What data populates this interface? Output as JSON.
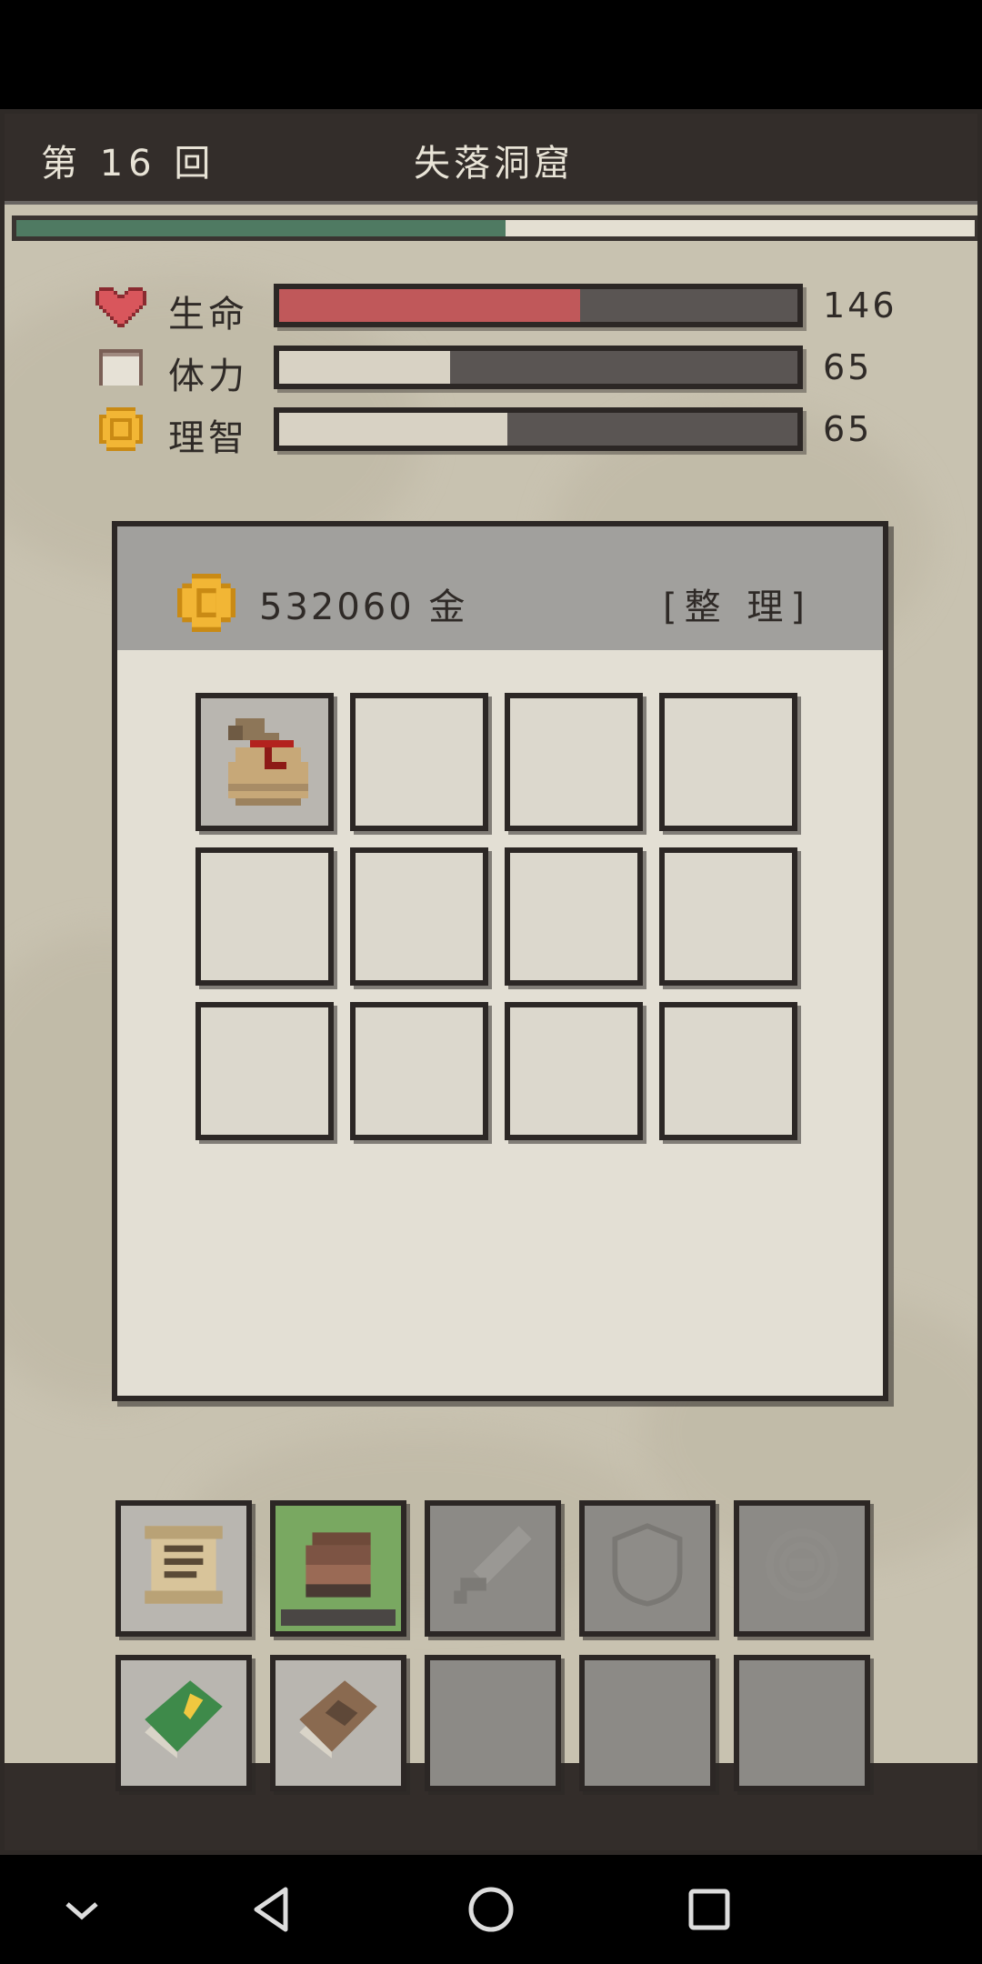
{
  "header": {
    "round": "第 16 回",
    "location": "失落洞窟"
  },
  "progress": {
    "fraction": 0.51,
    "fill_color": "#4f7a62"
  },
  "stats": [
    {
      "name": "生命",
      "icon": "heart-icon",
      "value": "146",
      "fraction": 0.58,
      "color": "#c0585a"
    },
    {
      "name": "体力",
      "icon": "stamina-icon",
      "value": "65",
      "fraction": 0.33,
      "color": "#d8d2c4"
    },
    {
      "name": "理智",
      "icon": "sanity-coin-icon",
      "value": "65",
      "fraction": 0.44,
      "color": "#d8d2c4"
    }
  ],
  "inventory": {
    "gold": "532060 金",
    "sort_label": "[整 理]",
    "slots": [
      "loot-bag-icon",
      "",
      "",
      "",
      "",
      "",
      "",
      "",
      "",
      "",
      "",
      ""
    ]
  },
  "tabs_row1": [
    {
      "icon": "scroll-icon",
      "state": "normal"
    },
    {
      "icon": "backpack-icon",
      "state": "active"
    },
    {
      "icon": "sword-icon",
      "state": "disabled"
    },
    {
      "icon": "shield-icon",
      "state": "disabled"
    },
    {
      "icon": "ring-icon",
      "state": "disabled"
    }
  ],
  "tabs_row2": [
    {
      "icon": "green-book-icon",
      "state": "normal"
    },
    {
      "icon": "brown-book-icon",
      "state": "normal"
    },
    {
      "icon": "",
      "state": "disabled"
    },
    {
      "icon": "",
      "state": "disabled"
    },
    {
      "icon": "",
      "state": "disabled"
    }
  ],
  "navbar": [
    "collapse-icon",
    "back-icon",
    "home-icon",
    "recents-icon"
  ]
}
